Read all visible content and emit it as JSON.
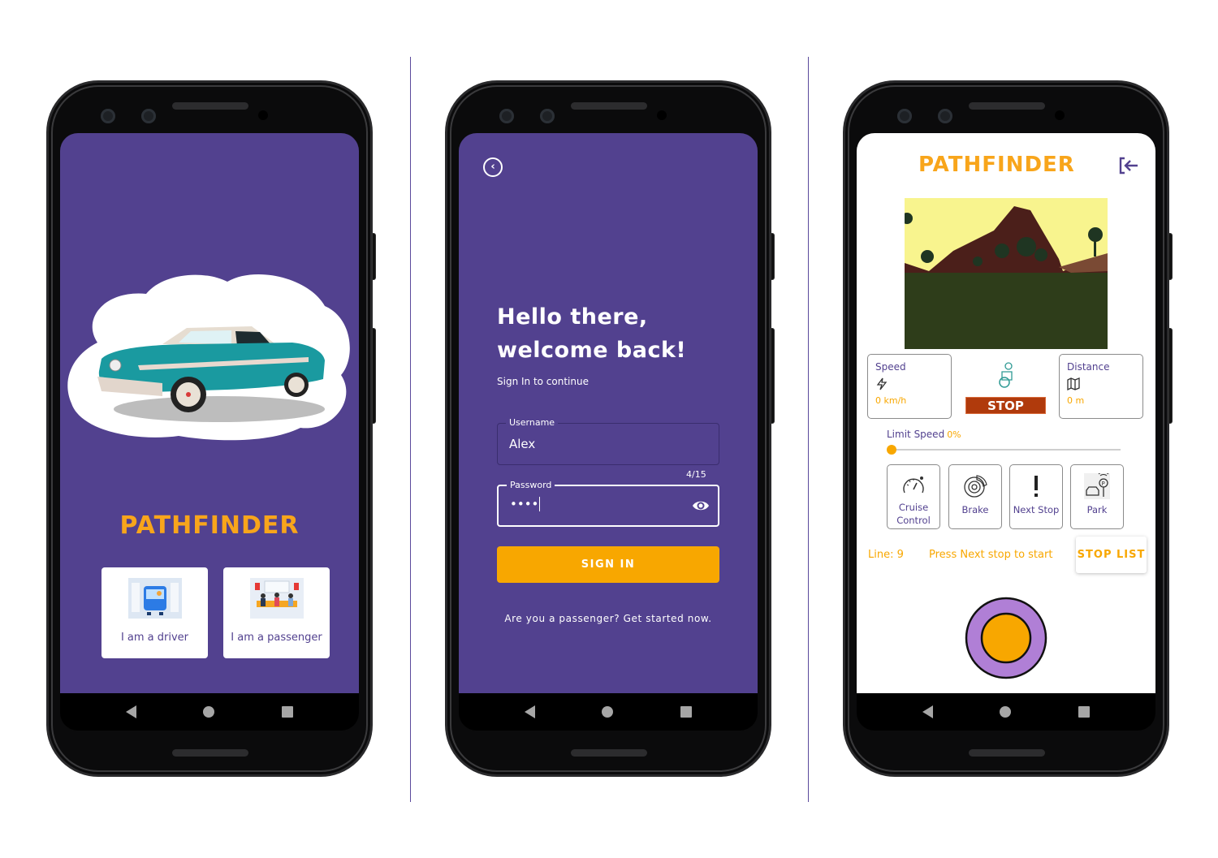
{
  "colors": {
    "primary": "#52418f",
    "accent": "#f8a700",
    "stop": "#b03a0c",
    "joystick_ring": "#b07fd6"
  },
  "screen1": {
    "brand": "PATHFINDER",
    "driver_card": {
      "label": "I am a driver",
      "icon": "bus-driver-illustration"
    },
    "passenger_card": {
      "label": "I am a passenger",
      "icon": "passengers-illustration"
    },
    "hero_image": "classic-car-illustration"
  },
  "screen2": {
    "back_icon": "back-chevron-circle-icon",
    "title_line1": "Hello there,",
    "title_line2": "welcome back!",
    "subtitle": "Sign In to continue",
    "username": {
      "label": "Username",
      "value": "Alex"
    },
    "password": {
      "label": "Password",
      "value": "••••",
      "counter": "4/15",
      "toggle_icon": "eye-icon"
    },
    "signin_label": "SIGN IN",
    "passenger_link": "Are you a passenger? Get started now."
  },
  "screen3": {
    "brand": "PATHFINDER",
    "logout_icon": "logout-icon",
    "speed": {
      "title": "Speed",
      "value": "0 km/h",
      "icon": "lightning-icon"
    },
    "distance": {
      "title": "Distance",
      "value": "0 m",
      "icon": "map-icon"
    },
    "status_label": "STOP",
    "limit_speed": {
      "label": "Limit Speed",
      "value": "0%",
      "fraction": 0
    },
    "controls": [
      {
        "label": "Cruise Control",
        "icon": "speedometer-icon"
      },
      {
        "label": "Brake",
        "icon": "brake-disc-icon"
      },
      {
        "label": "Next Stop",
        "icon": "exclamation-icon"
      },
      {
        "label": "Park",
        "icon": "parking-icon"
      }
    ],
    "line": "Line: 9",
    "next_hint": "Press Next stop to start",
    "stop_list_label": "STOP LIST"
  },
  "navbar": {
    "back": "back-icon",
    "home": "home-icon",
    "recent": "recent-apps-icon"
  }
}
